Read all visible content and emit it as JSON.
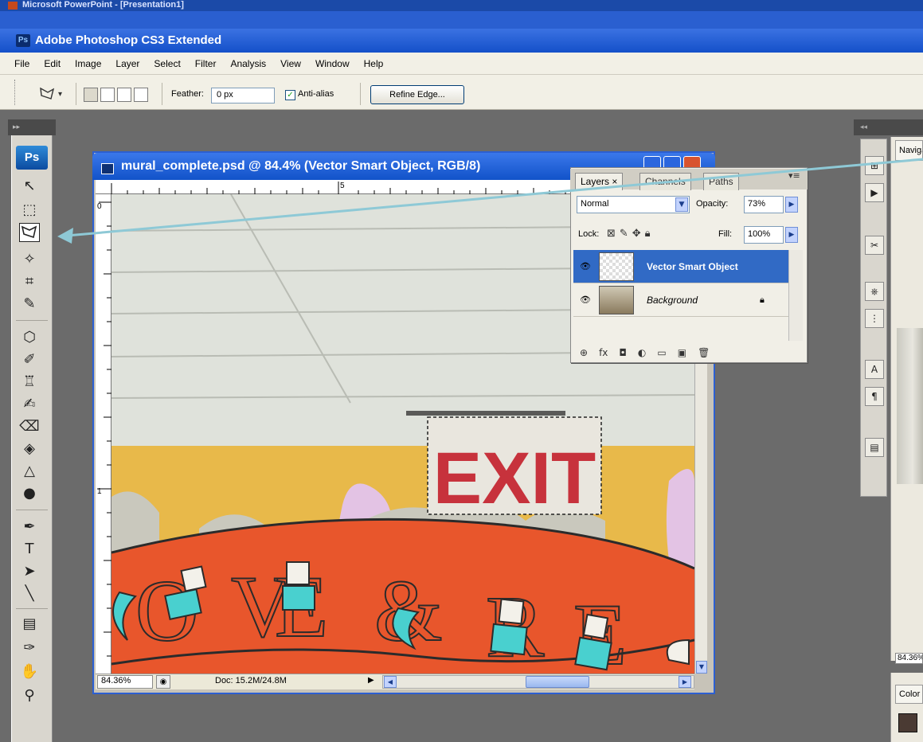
{
  "background_app": {
    "title": "Microsoft PowerPoint - [Presentation1]"
  },
  "app": {
    "title": "Adobe Photoshop CS3 Extended",
    "logo": "Ps"
  },
  "menu": [
    "File",
    "Edit",
    "Image",
    "Layer",
    "Select",
    "Filter",
    "Analysis",
    "View",
    "Window",
    "Help"
  ],
  "options": {
    "feather_label": "Feather:",
    "feather_value": "0 px",
    "antialias_label": "Anti-alias",
    "antialias_checked": true,
    "refine_edge_label": "Refine Edge..."
  },
  "toolbox": {
    "badge": "Ps",
    "active_tool": "polygonal-lasso"
  },
  "document": {
    "title": "mural_complete.psd @ 84.4% (Vector Smart Object, RGB/8)",
    "zoom": "84.36%",
    "doc_info": "Doc: 15.2M/24.8M",
    "ruler_top_mark": "5",
    "ruler_left_top": "0",
    "ruler_left_mark": "1",
    "canvas": {
      "sign_text": "EXIT",
      "banner_letters": [
        "O",
        "V",
        "E",
        "&",
        "R",
        "E"
      ]
    }
  },
  "layers_panel": {
    "tabs": [
      "Layers ×",
      "Channels",
      "Paths"
    ],
    "blend_mode": "Normal",
    "opacity_label": "Opacity:",
    "opacity_value": "73%",
    "lock_label": "Lock:",
    "fill_label": "Fill:",
    "fill_value": "100%",
    "layers": [
      {
        "name": "Vector Smart Object",
        "selected": true
      },
      {
        "name": "Background",
        "selected": false,
        "locked": true
      }
    ],
    "footer_icons": [
      "link-icon",
      "fx-icon",
      "mask-icon",
      "adjustment-icon",
      "folder-icon",
      "new-layer-icon",
      "trash-icon"
    ]
  },
  "right_dock": {
    "navigator_tab": "Navigator",
    "navigator_zoom": "84.36%",
    "color_tab": "Color"
  },
  "colors": {
    "title_blue": "#1450c9",
    "selection_blue": "#316ac5",
    "wall_yellow": "#e8b94a",
    "banner_orange": "#e8562c",
    "exit_red": "#c7323c",
    "letter_teal": "#49d0cf"
  }
}
